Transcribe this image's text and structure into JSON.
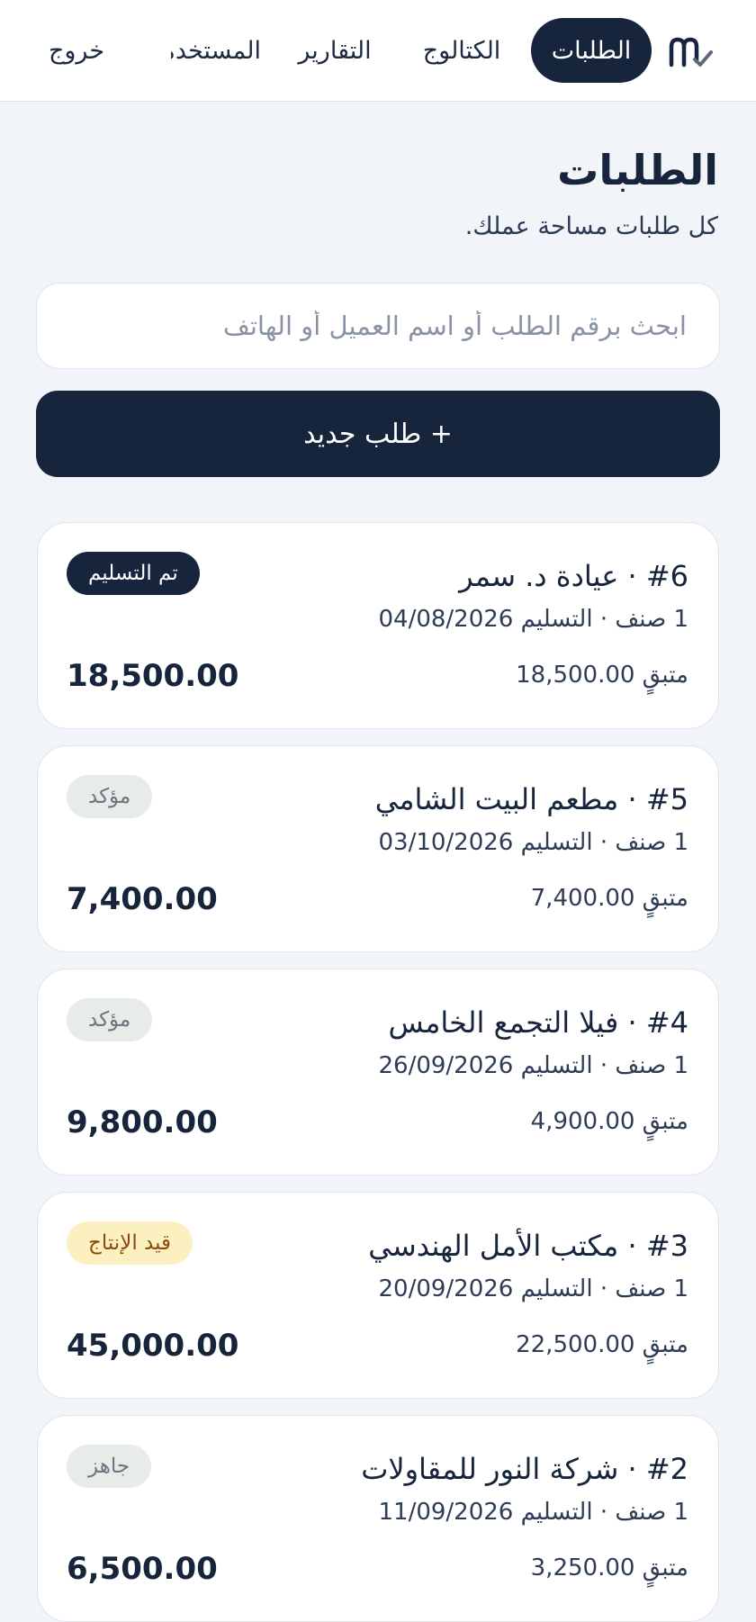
{
  "nav": {
    "orders": "الطلبات",
    "catalog": "الكتالوج",
    "reports": "التقارير",
    "clipped": "المستخدمون",
    "logout": "خروج"
  },
  "page": {
    "title": "الطلبات",
    "subtitle": "كل طلبات مساحة عملك."
  },
  "search": {
    "placeholder": "ابحث برقم الطلب أو اسم العميل أو الهاتف"
  },
  "new_order_label": "+ طلب جديد",
  "orders": [
    {
      "title": "#6 · عيادة د. سمر",
      "meta": "1 صنف · التسليم 04/08/2026",
      "remaining": "متبقٍ 18,500.00",
      "total": "18,500.00",
      "status": "تم التسليم"
    },
    {
      "title": "#5 · مطعم البيت الشامي",
      "meta": "1 صنف · التسليم 03/10/2026",
      "remaining": "متبقٍ 7,400.00",
      "total": "7,400.00",
      "status": "مؤكد"
    },
    {
      "title": "#4 · فيلا التجمع الخامس",
      "meta": "1 صنف · التسليم 26/09/2026",
      "remaining": "متبقٍ 4,900.00",
      "total": "9,800.00",
      "status": "مؤكد"
    },
    {
      "title": "#3 · مكتب الأمل الهندسي",
      "meta": "1 صنف · التسليم 20/09/2026",
      "remaining": "متبقٍ 22,500.00",
      "total": "45,000.00",
      "status": "قيد الإنتاج"
    },
    {
      "title": "#2 · شركة النور للمقاولات",
      "meta": "1 صنف · التسليم 11/09/2026",
      "remaining": "متبقٍ 3,250.00",
      "total": "6,500.00",
      "status": "جاهز"
    }
  ],
  "colors": {
    "primary": "#16243c",
    "background": "#f1f4f8",
    "badge_confirmed_bg": "#e7ece9",
    "badge_production_bg": "#fdf0c0",
    "badge_production_text": "#8a4a10"
  }
}
